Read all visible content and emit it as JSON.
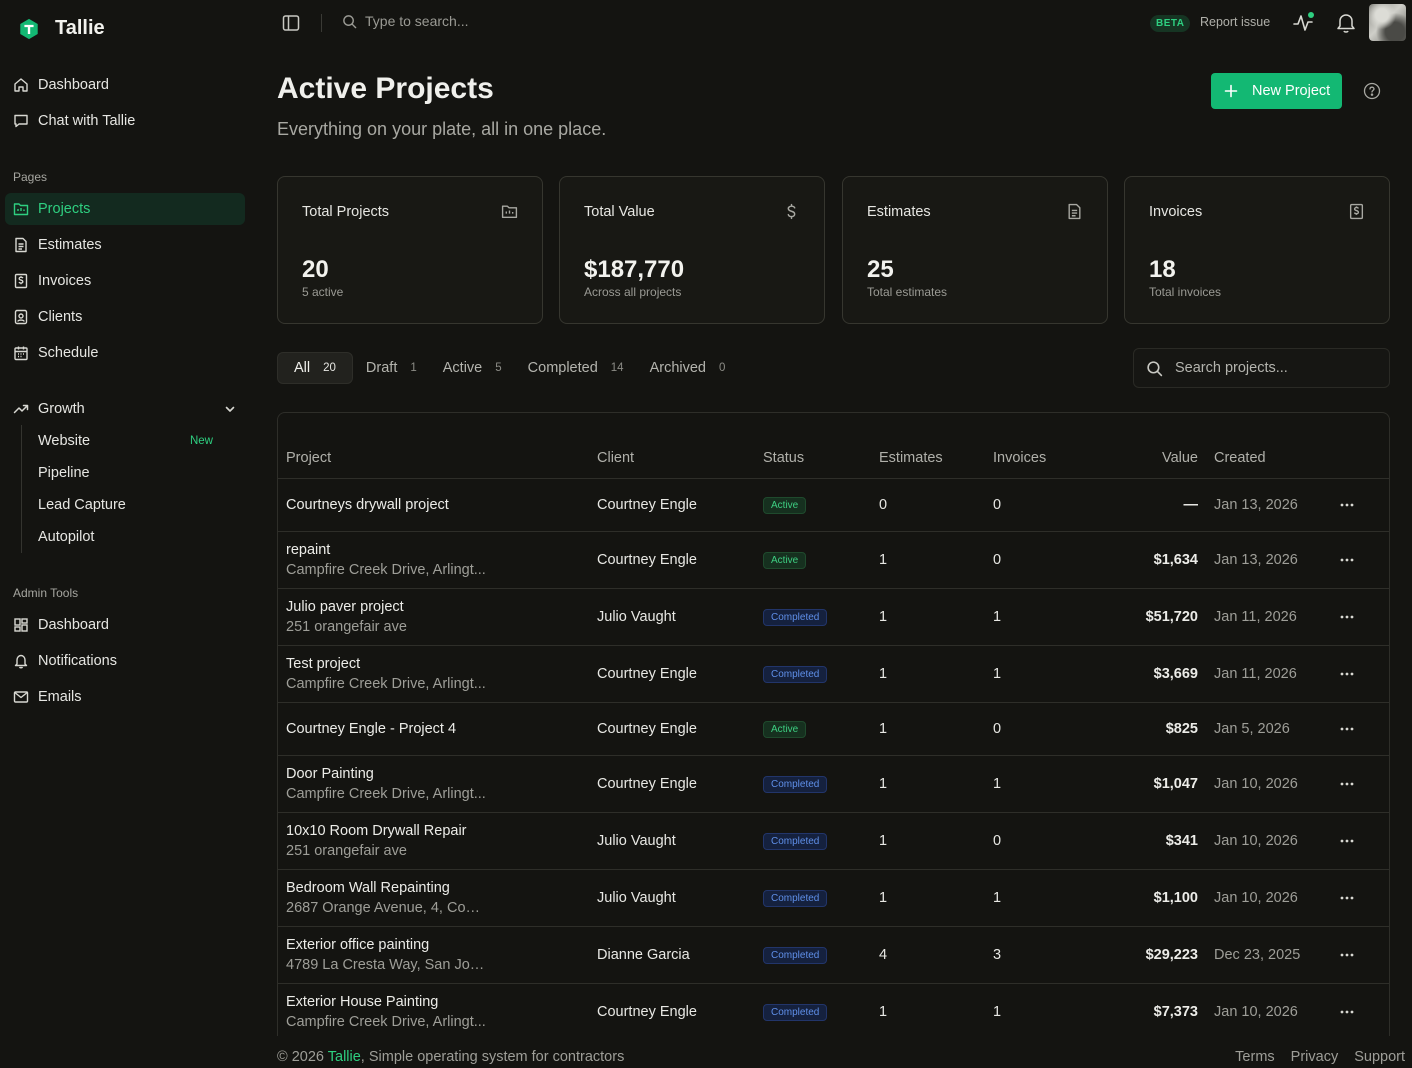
{
  "app": {
    "name": "Tallie",
    "accent_color": "#13b873",
    "logo_icon": "tallie-logo-icon"
  },
  "sidebar": {
    "top_items": [
      {
        "label": "Dashboard",
        "icon": "home-icon"
      },
      {
        "label": "Chat with Tallie",
        "icon": "chat-icon"
      }
    ],
    "pages_label": "Pages",
    "pages": [
      {
        "label": "Projects",
        "icon": "folder-icon",
        "active": true
      },
      {
        "label": "Estimates",
        "icon": "document-icon"
      },
      {
        "label": "Invoices",
        "icon": "invoice-icon"
      },
      {
        "label": "Clients",
        "icon": "contact-icon"
      },
      {
        "label": "Schedule",
        "icon": "calendar-icon"
      }
    ],
    "growth": {
      "label": "Growth",
      "icon": "trending-up-icon",
      "expanded": true,
      "items": [
        {
          "label": "Website",
          "badge": "New"
        },
        {
          "label": "Pipeline"
        },
        {
          "label": "Lead Capture"
        },
        {
          "label": "Autopilot"
        }
      ]
    },
    "admin_label": "Admin Tools",
    "admin_items": [
      {
        "label": "Dashboard",
        "icon": "grid-icon"
      },
      {
        "label": "Notifications",
        "icon": "bell-icon"
      },
      {
        "label": "Emails",
        "icon": "mail-icon"
      }
    ]
  },
  "topbar": {
    "search_placeholder": "Type to search...",
    "beta_label": "BETA",
    "report_label": "Report issue"
  },
  "header": {
    "title": "Active Projects",
    "subtitle": "Everything on your plate, all in one place.",
    "new_button_label": "New Project"
  },
  "stats": [
    {
      "title": "Total Projects",
      "value": "20",
      "sub": "5 active",
      "icon": "folder-icon"
    },
    {
      "title": "Total Value",
      "value": "$187,770",
      "sub": "Across all projects",
      "icon": "dollar-icon"
    },
    {
      "title": "Estimates",
      "value": "25",
      "sub": "Total estimates",
      "icon": "document-icon"
    },
    {
      "title": "Invoices",
      "value": "18",
      "sub": "Total invoices",
      "icon": "invoice-icon"
    }
  ],
  "tabs": [
    {
      "label": "All",
      "count": "20",
      "active": true
    },
    {
      "label": "Draft",
      "count": "1"
    },
    {
      "label": "Active",
      "count": "5"
    },
    {
      "label": "Completed",
      "count": "14"
    },
    {
      "label": "Archived",
      "count": "0"
    }
  ],
  "project_search_placeholder": "Search projects...",
  "table": {
    "columns": [
      "Project",
      "Client",
      "Status",
      "Estimates",
      "Invoices",
      "Value",
      "Created"
    ],
    "rows": [
      {
        "name": "Courtneys drywall project",
        "address": "",
        "client": "Courtney Engle",
        "status": "Active",
        "estimates": "0",
        "invoices": "0",
        "value": "—",
        "created": "Jan 13, 2026"
      },
      {
        "name": "repaint",
        "address": "Campfire Creek Drive, Arlingt...",
        "client": "Courtney Engle",
        "status": "Active",
        "estimates": "1",
        "invoices": "0",
        "value": "$1,634",
        "created": "Jan 13, 2026"
      },
      {
        "name": "Julio paver project",
        "address": "251 orangefair ave",
        "client": "Julio Vaught",
        "status": "Completed",
        "estimates": "1",
        "invoices": "1",
        "value": "$51,720",
        "created": "Jan 11, 2026"
      },
      {
        "name": "Test project",
        "address": "Campfire Creek Drive, Arlingt...",
        "client": "Courtney Engle",
        "status": "Completed",
        "estimates": "1",
        "invoices": "1",
        "value": "$3,669",
        "created": "Jan 11, 2026"
      },
      {
        "name": "Courtney Engle - Project 4",
        "address": "",
        "client": "Courtney Engle",
        "status": "Active",
        "estimates": "1",
        "invoices": "0",
        "value": "$825",
        "created": "Jan 5, 2026"
      },
      {
        "name": "Door Painting",
        "address": "Campfire Creek Drive, Arlingt...",
        "client": "Courtney Engle",
        "status": "Completed",
        "estimates": "1",
        "invoices": "1",
        "value": "$1,047",
        "created": "Jan 10, 2026"
      },
      {
        "name": "10x10 Room Drywall Repair",
        "address": "251 orangefair ave",
        "client": "Julio Vaught",
        "status": "Completed",
        "estimates": "1",
        "invoices": "0",
        "value": "$341",
        "created": "Jan 10, 2026"
      },
      {
        "name": "Bedroom Wall Repainting",
        "address": "2687 Orange Avenue, 4, Cost...",
        "client": "Julio Vaught",
        "status": "Completed",
        "estimates": "1",
        "invoices": "1",
        "value": "$1,100",
        "created": "Jan 10, 2026"
      },
      {
        "name": "Exterior office painting",
        "address": "4789 La Cresta Way, San Jos...",
        "client": "Dianne Garcia",
        "status": "Completed",
        "estimates": "4",
        "invoices": "3",
        "value": "$29,223",
        "created": "Dec 23, 2025"
      },
      {
        "name": "Exterior House Painting",
        "address": "Campfire Creek Drive, Arlingt...",
        "client": "Courtney Engle",
        "status": "Completed",
        "estimates": "1",
        "invoices": "1",
        "value": "$7,373",
        "created": "Jan 10, 2026"
      }
    ]
  },
  "footer": {
    "copyright_prefix": "© 2026 ",
    "brand_link": "Tallie",
    "tagline": ", Simple operating system for contractors",
    "links": [
      "Terms",
      "Privacy",
      "Support"
    ]
  }
}
